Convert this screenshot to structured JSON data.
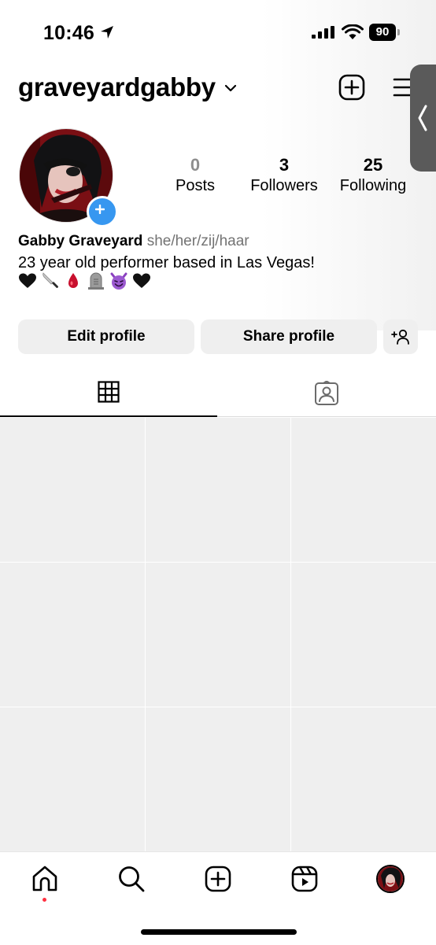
{
  "status_bar": {
    "time": "10:46",
    "battery": "90"
  },
  "header": {
    "username": "graveyardgabby"
  },
  "profile": {
    "stats": [
      {
        "value": "0",
        "label": "Posts"
      },
      {
        "value": "3",
        "label": "Followers"
      },
      {
        "value": "25",
        "label": "Following"
      }
    ],
    "display_name": "Gabby Graveyard",
    "pronouns": "she/her/zij/haar",
    "bio": "23 year old performer based in Las Vegas!",
    "bio_emojis": [
      "black-heart",
      "knife",
      "drop-of-blood",
      "headstone",
      "smiling-face-with-horns",
      "black-heart"
    ]
  },
  "actions": {
    "edit_label": "Edit profile",
    "share_label": "Share profile"
  },
  "tabs": [
    {
      "name": "posts-grid",
      "active": true
    },
    {
      "name": "tagged",
      "active": false
    }
  ],
  "grid": {
    "rows": 3,
    "cols": 3
  },
  "bottom_nav": [
    "home",
    "search",
    "create",
    "reels",
    "profile"
  ],
  "colors": {
    "accent_blue": "#3797f0",
    "placeholder": "#efefef",
    "notification": "#ff3040"
  }
}
